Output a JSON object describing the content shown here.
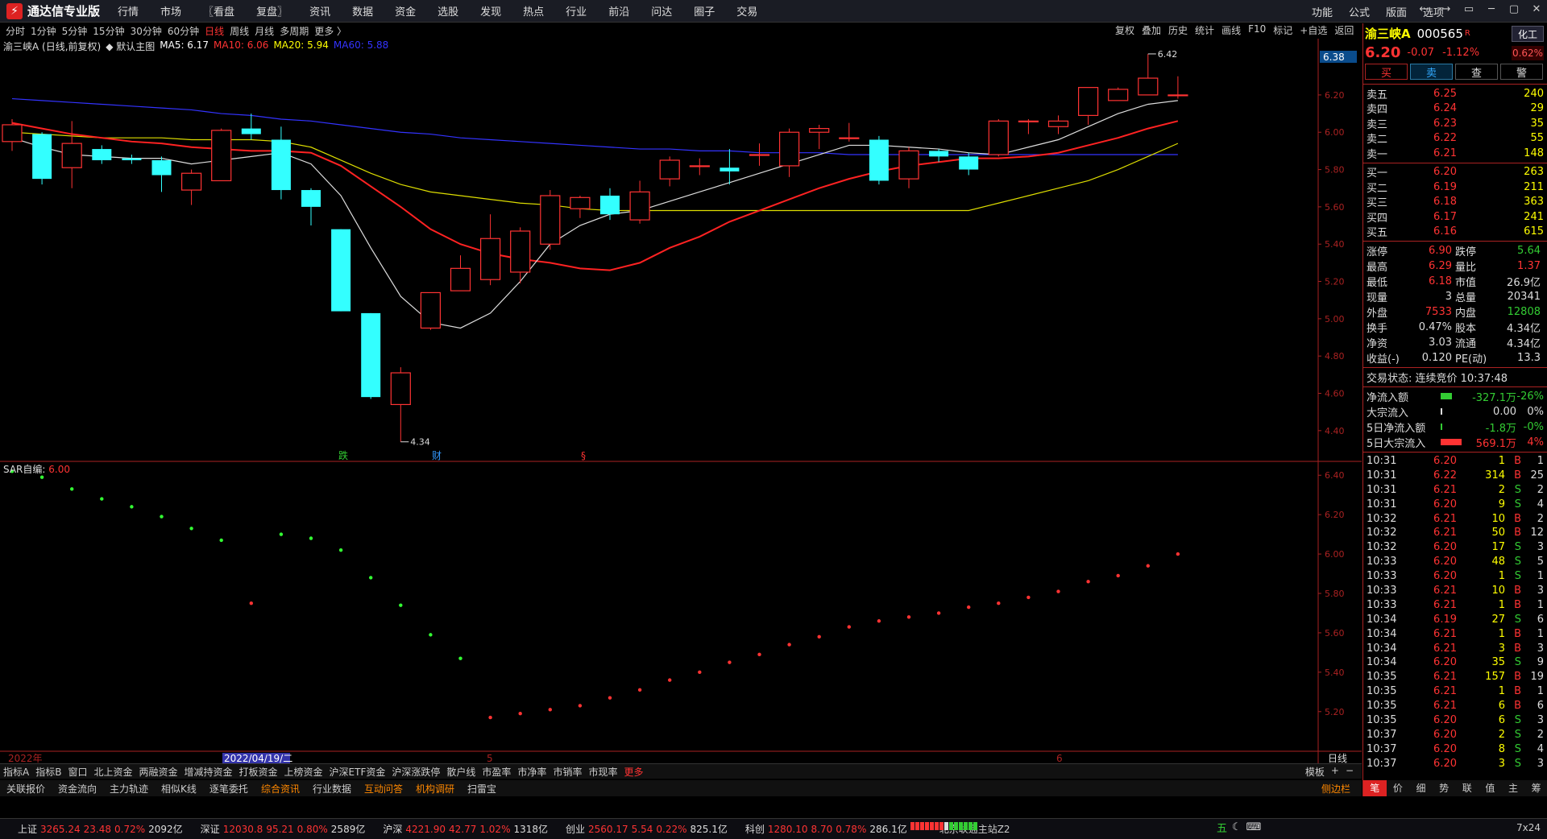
{
  "app": {
    "name": "通达信专业版"
  },
  "menu": [
    "行情",
    "市场",
    "〖看盘",
    "复盘〗",
    "资讯",
    "数据",
    "资金",
    "选股",
    "发现",
    "热点",
    "行业",
    "前沿",
    "问达",
    "圈子",
    "交易"
  ],
  "right_menu": [
    "功能",
    "公式",
    "版面",
    "选项"
  ],
  "window_controls": [
    "←",
    "→",
    "▭",
    "─",
    "▢",
    "✕"
  ],
  "periods": [
    "分时",
    "1分钟",
    "5分钟",
    "15分钟",
    "30分钟",
    "60分钟",
    "日线",
    "周线",
    "月线",
    "多周期",
    "更多 〉"
  ],
  "active_period": "日线",
  "chart_tools": [
    "复权",
    "叠加",
    "历史",
    "统计",
    "画线",
    "F10",
    "标记",
    "+自选",
    "返回"
  ],
  "info_line": {
    "name": "渝三峡A (日线,前复权)",
    "main_label": "◆ 默认主图",
    "ma5": "MA5: 6.17",
    "ma10": "MA10: 6.06",
    "ma20": "MA20: 5.94",
    "ma60": "MA60: 5.88"
  },
  "sar_line": {
    "label": "SAR自编",
    "value": "6.00"
  },
  "chart_data": {
    "type": "candlestick",
    "ylim": [
      4.3,
      6.45
    ],
    "yticks": [
      "6.20",
      "6.00",
      "5.80",
      "5.60",
      "5.40",
      "5.20",
      "5.00",
      "4.80",
      "4.60",
      "4.40"
    ],
    "top_label": "6.38",
    "high_label": "6.42",
    "low_label": "4.34",
    "x_labels": [
      "2022年",
      "2022/04/19/二",
      "5",
      "6"
    ],
    "markers": [
      "跌",
      "财",
      "§"
    ],
    "candles": [
      {
        "o": 5.95,
        "c": 6.04,
        "h": 6.07,
        "l": 5.9
      },
      {
        "o": 5.99,
        "c": 5.75,
        "h": 6.0,
        "l": 5.72
      },
      {
        "o": 5.81,
        "c": 5.94,
        "h": 6.06,
        "l": 5.7
      },
      {
        "o": 5.91,
        "c": 5.85,
        "h": 5.93,
        "l": 5.83
      },
      {
        "o": 5.86,
        "c": 5.85,
        "h": 5.88,
        "l": 5.83
      },
      {
        "o": 5.85,
        "c": 5.77,
        "h": 5.87,
        "l": 5.68
      },
      {
        "o": 5.69,
        "c": 5.78,
        "h": 5.8,
        "l": 5.61
      },
      {
        "o": 5.74,
        "c": 6.01,
        "h": 6.02,
        "l": 5.74
      },
      {
        "o": 6.02,
        "c": 5.99,
        "h": 6.1,
        "l": 5.96
      },
      {
        "o": 5.96,
        "c": 5.69,
        "h": 6.03,
        "l": 5.64
      },
      {
        "o": 5.69,
        "c": 5.6,
        "h": 5.7,
        "l": 5.5
      },
      {
        "o": 5.48,
        "c": 5.04,
        "h": 5.48,
        "l": 5.04
      },
      {
        "o": 5.03,
        "c": 4.58,
        "h": 5.03,
        "l": 4.57
      },
      {
        "o": 4.54,
        "c": 4.71,
        "h": 4.74,
        "l": 4.34
      },
      {
        "o": 4.95,
        "c": 5.14,
        "h": 5.14,
        "l": 4.94
      },
      {
        "o": 5.15,
        "c": 5.27,
        "h": 5.34,
        "l": 5.15
      },
      {
        "o": 5.21,
        "c": 5.43,
        "h": 5.56,
        "l": 5.18
      },
      {
        "o": 5.25,
        "c": 5.47,
        "h": 5.49,
        "l": 5.19
      },
      {
        "o": 5.4,
        "c": 5.66,
        "h": 5.69,
        "l": 5.37
      },
      {
        "o": 5.59,
        "c": 5.65,
        "h": 5.66,
        "l": 5.54
      },
      {
        "o": 5.66,
        "c": 5.56,
        "h": 5.7,
        "l": 5.53
      },
      {
        "o": 5.53,
        "c": 5.68,
        "h": 5.74,
        "l": 5.51
      },
      {
        "o": 5.75,
        "c": 5.85,
        "h": 5.87,
        "l": 5.71
      },
      {
        "o": 5.82,
        "c": 5.82,
        "h": 5.86,
        "l": 5.77
      },
      {
        "o": 5.81,
        "c": 5.79,
        "h": 5.91,
        "l": 5.72
      },
      {
        "o": 5.88,
        "c": 5.88,
        "h": 5.94,
        "l": 5.82
      },
      {
        "o": 5.82,
        "c": 6.0,
        "h": 6.02,
        "l": 5.76
      },
      {
        "o": 6.0,
        "c": 6.02,
        "h": 6.04,
        "l": 5.91
      },
      {
        "o": 5.97,
        "c": 5.97,
        "h": 6.05,
        "l": 5.95
      },
      {
        "o": 5.96,
        "c": 5.74,
        "h": 5.98,
        "l": 5.72
      },
      {
        "o": 5.75,
        "c": 5.9,
        "h": 5.92,
        "l": 5.7
      },
      {
        "o": 5.9,
        "c": 5.87,
        "h": 5.91,
        "l": 5.84
      },
      {
        "o": 5.87,
        "c": 5.8,
        "h": 5.89,
        "l": 5.77
      },
      {
        "o": 5.88,
        "c": 6.06,
        "h": 6.07,
        "l": 5.87
      },
      {
        "o": 6.06,
        "c": 6.06,
        "h": 6.07,
        "l": 5.99
      },
      {
        "o": 6.03,
        "c": 6.06,
        "h": 6.09,
        "l": 5.99
      },
      {
        "o": 6.09,
        "c": 6.24,
        "h": 6.24,
        "l": 6.04
      },
      {
        "o": 6.17,
        "c": 6.23,
        "h": 6.24,
        "l": 6.17
      },
      {
        "o": 6.2,
        "c": 6.29,
        "h": 6.42,
        "l": 6.2
      },
      {
        "o": 6.2,
        "c": 6.2,
        "h": 6.3,
        "l": 6.18
      }
    ],
    "ma5": [
      5.97,
      5.92,
      5.88,
      5.87,
      5.86,
      5.86,
      5.83,
      5.85,
      5.87,
      5.89,
      5.83,
      5.66,
      5.38,
      5.12,
      4.98,
      4.95,
      5.03,
      5.2,
      5.4,
      5.5,
      5.56,
      5.58,
      5.63,
      5.68,
      5.73,
      5.78,
      5.83,
      5.88,
      5.93,
      5.93,
      5.92,
      5.91,
      5.89,
      5.88,
      5.92,
      5.96,
      6.03,
      6.1,
      6.15,
      6.17
    ],
    "ma10": [
      6.05,
      6.02,
      5.99,
      5.97,
      5.95,
      5.94,
      5.92,
      5.91,
      5.9,
      5.9,
      5.89,
      5.82,
      5.71,
      5.6,
      5.48,
      5.4,
      5.35,
      5.32,
      5.3,
      5.27,
      5.26,
      5.3,
      5.38,
      5.44,
      5.52,
      5.58,
      5.64,
      5.7,
      5.75,
      5.79,
      5.82,
      5.84,
      5.86,
      5.86,
      5.87,
      5.89,
      5.93,
      5.97,
      6.02,
      6.06
    ],
    "ma20": [
      6.0,
      5.99,
      5.98,
      5.97,
      5.97,
      5.97,
      5.96,
      5.96,
      5.96,
      5.95,
      5.92,
      5.85,
      5.78,
      5.72,
      5.68,
      5.66,
      5.64,
      5.62,
      5.61,
      5.59,
      5.58,
      5.58,
      5.58,
      5.58,
      5.58,
      5.58,
      5.58,
      5.58,
      5.58,
      5.58,
      5.58,
      5.58,
      5.58,
      5.62,
      5.66,
      5.7,
      5.74,
      5.8,
      5.87,
      5.94
    ],
    "ma60": [
      6.18,
      6.17,
      6.16,
      6.15,
      6.14,
      6.13,
      6.12,
      6.1,
      6.09,
      6.07,
      6.06,
      6.04,
      6.02,
      6.0,
      5.99,
      5.97,
      5.96,
      5.95,
      5.94,
      5.93,
      5.92,
      5.91,
      5.91,
      5.9,
      5.9,
      5.89,
      5.89,
      5.89,
      5.88,
      5.88,
      5.88,
      5.88,
      5.88,
      5.88,
      5.88,
      5.88,
      5.88,
      5.88,
      5.88,
      5.88
    ],
    "ma60_start_index": 0,
    "sar": {
      "ylim": [
        5.15,
        6.45
      ],
      "yticks": [
        "6.40",
        "6.20",
        "6.00",
        "5.80",
        "5.60",
        "5.40",
        "5.20"
      ],
      "points": [
        {
          "i": 0,
          "v": 6.42,
          "up": false
        },
        {
          "i": 1,
          "v": 6.39,
          "up": false
        },
        {
          "i": 2,
          "v": 6.33,
          "up": false
        },
        {
          "i": 3,
          "v": 6.28,
          "up": false
        },
        {
          "i": 4,
          "v": 6.24,
          "up": false
        },
        {
          "i": 5,
          "v": 6.19,
          "up": false
        },
        {
          "i": 6,
          "v": 6.13,
          "up": false
        },
        {
          "i": 7,
          "v": 6.07,
          "up": false
        },
        {
          "i": 9,
          "v": 6.1,
          "up": false
        },
        {
          "i": 10,
          "v": 6.08,
          "up": false
        },
        {
          "i": 11,
          "v": 6.02,
          "up": false
        },
        {
          "i": 12,
          "v": 5.88,
          "up": false
        },
        {
          "i": 8,
          "v": 5.75,
          "up": true
        },
        {
          "i": 13,
          "v": 5.74,
          "up": false
        },
        {
          "i": 14,
          "v": 5.59,
          "up": false
        },
        {
          "i": 15,
          "v": 5.47,
          "up": false
        },
        {
          "i": 16,
          "v": 5.17,
          "up": true
        },
        {
          "i": 17,
          "v": 5.19,
          "up": true
        },
        {
          "i": 18,
          "v": 5.21,
          "up": true
        },
        {
          "i": 19,
          "v": 5.23,
          "up": true
        },
        {
          "i": 20,
          "v": 5.27,
          "up": true
        },
        {
          "i": 21,
          "v": 5.31,
          "up": true
        },
        {
          "i": 22,
          "v": 5.36,
          "up": true
        },
        {
          "i": 23,
          "v": 5.4,
          "up": true
        },
        {
          "i": 24,
          "v": 5.45,
          "up": true
        },
        {
          "i": 25,
          "v": 5.49,
          "up": true
        },
        {
          "i": 26,
          "v": 5.54,
          "up": true
        },
        {
          "i": 27,
          "v": 5.58,
          "up": true
        },
        {
          "i": 28,
          "v": 5.63,
          "up": true
        },
        {
          "i": 29,
          "v": 5.66,
          "up": true
        },
        {
          "i": 30,
          "v": 5.68,
          "up": true
        },
        {
          "i": 31,
          "v": 5.7,
          "up": true
        },
        {
          "i": 32,
          "v": 5.73,
          "up": true
        },
        {
          "i": 33,
          "v": 5.75,
          "up": true
        },
        {
          "i": 34,
          "v": 5.78,
          "up": true
        },
        {
          "i": 35,
          "v": 5.81,
          "up": true
        },
        {
          "i": 36,
          "v": 5.86,
          "up": true
        },
        {
          "i": 37,
          "v": 5.89,
          "up": true
        },
        {
          "i": 38,
          "v": 5.94,
          "up": true
        },
        {
          "i": 39,
          "v": 6.0,
          "up": true
        }
      ]
    }
  },
  "stock": {
    "name": "渝三峡A",
    "code": "000565",
    "tag": "R",
    "sector": "化工",
    "price": "6.20",
    "change": "-0.07",
    "pct": "-1.12%",
    "badge": "0.62%"
  },
  "trade_buttons": [
    "买",
    "卖",
    "查",
    "警"
  ],
  "asks": [
    {
      "l": "卖五",
      "p": "6.25",
      "v": "240"
    },
    {
      "l": "卖四",
      "p": "6.24",
      "v": "29"
    },
    {
      "l": "卖三",
      "p": "6.23",
      "v": "35"
    },
    {
      "l": "卖二",
      "p": "6.22",
      "v": "55"
    },
    {
      "l": "卖一",
      "p": "6.21",
      "v": "148"
    }
  ],
  "bids": [
    {
      "l": "买一",
      "p": "6.20",
      "v": "263"
    },
    {
      "l": "买二",
      "p": "6.19",
      "v": "211"
    },
    {
      "l": "买三",
      "p": "6.18",
      "v": "363"
    },
    {
      "l": "买四",
      "p": "6.17",
      "v": "241"
    },
    {
      "l": "买五",
      "p": "6.16",
      "v": "615"
    }
  ],
  "stats": [
    {
      "l": "涨停",
      "v": "6.90",
      "c": "red"
    },
    {
      "l": "跌停",
      "v": "5.64",
      "c": "green"
    },
    {
      "l": "最高",
      "v": "6.29",
      "c": "red"
    },
    {
      "l": "量比",
      "v": "1.37",
      "c": "red"
    },
    {
      "l": "最低",
      "v": "6.18",
      "c": "red"
    },
    {
      "l": "市值",
      "v": "26.9亿",
      "c": "wht"
    },
    {
      "l": "现量",
      "v": "3",
      "c": "wht"
    },
    {
      "l": "总量",
      "v": "20341",
      "c": "wht"
    },
    {
      "l": "外盘",
      "v": "7533",
      "c": "red"
    },
    {
      "l": "内盘",
      "v": "12808",
      "c": "green"
    },
    {
      "l": "换手",
      "v": "0.47%",
      "c": "wht"
    },
    {
      "l": "股本",
      "v": "4.34亿",
      "c": "wht"
    },
    {
      "l": "净资",
      "v": "3.03",
      "c": "wht"
    },
    {
      "l": "流通",
      "v": "4.34亿",
      "c": "wht"
    },
    {
      "l": "收益(-)",
      "v": "0.120",
      "c": "wht"
    },
    {
      "l": "PE(动)",
      "v": "13.3",
      "c": "wht"
    }
  ],
  "trade_status": "交易状态: 连续竞价 10:37:48",
  "flows": [
    {
      "l": "净流入额",
      "v": "-327.1万",
      "p": "-26%",
      "c": "green",
      "w": 14
    },
    {
      "l": "大宗流入",
      "v": "0.00",
      "p": "0%",
      "c": "wht",
      "w": 2
    },
    {
      "l": "5日净流入额",
      "v": "-1.8万",
      "p": "-0%",
      "c": "green",
      "w": 2
    },
    {
      "l": "5日大宗流入",
      "v": "569.1万",
      "p": "4%",
      "c": "red",
      "w": 26
    }
  ],
  "ticks": [
    {
      "t": "10:31",
      "p": "6.20",
      "v": "1",
      "d": "B",
      "n": "1"
    },
    {
      "t": "10:31",
      "p": "6.22",
      "v": "314",
      "d": "B",
      "n": "25"
    },
    {
      "t": "10:31",
      "p": "6.21",
      "v": "2",
      "d": "S",
      "n": "2"
    },
    {
      "t": "10:31",
      "p": "6.20",
      "v": "9",
      "d": "S",
      "n": "4"
    },
    {
      "t": "10:32",
      "p": "6.21",
      "v": "10",
      "d": "B",
      "n": "2"
    },
    {
      "t": "10:32",
      "p": "6.21",
      "v": "50",
      "d": "B",
      "n": "12"
    },
    {
      "t": "10:32",
      "p": "6.20",
      "v": "17",
      "d": "S",
      "n": "3"
    },
    {
      "t": "10:33",
      "p": "6.20",
      "v": "48",
      "d": "S",
      "n": "5"
    },
    {
      "t": "10:33",
      "p": "6.20",
      "v": "1",
      "d": "S",
      "n": "1"
    },
    {
      "t": "10:33",
      "p": "6.21",
      "v": "10",
      "d": "B",
      "n": "3"
    },
    {
      "t": "10:33",
      "p": "6.21",
      "v": "1",
      "d": "B",
      "n": "1"
    },
    {
      "t": "10:34",
      "p": "6.19",
      "v": "27",
      "d": "S",
      "n": "6"
    },
    {
      "t": "10:34",
      "p": "6.21",
      "v": "1",
      "d": "B",
      "n": "1"
    },
    {
      "t": "10:34",
      "p": "6.21",
      "v": "3",
      "d": "B",
      "n": "3"
    },
    {
      "t": "10:34",
      "p": "6.20",
      "v": "35",
      "d": "S",
      "n": "9"
    },
    {
      "t": "10:35",
      "p": "6.21",
      "v": "157",
      "d": "B",
      "n": "19"
    },
    {
      "t": "10:35",
      "p": "6.21",
      "v": "1",
      "d": "B",
      "n": "1"
    },
    {
      "t": "10:35",
      "p": "6.21",
      "v": "6",
      "d": "B",
      "n": "6"
    },
    {
      "t": "10:35",
      "p": "6.20",
      "v": "6",
      "d": "S",
      "n": "3"
    },
    {
      "t": "10:37",
      "p": "6.20",
      "v": "2",
      "d": "S",
      "n": "2"
    },
    {
      "t": "10:37",
      "p": "6.20",
      "v": "8",
      "d": "S",
      "n": "4"
    },
    {
      "t": "10:37",
      "p": "6.20",
      "v": "3",
      "d": "S",
      "n": "3"
    }
  ],
  "side_tabs": [
    "笔",
    "价",
    "细",
    "势",
    "联",
    "值",
    "主",
    "筹"
  ],
  "tabbar1": [
    "指标A",
    "指标B",
    "窗口",
    "北上资金",
    "两融资金",
    "增减持资金",
    "打板资金",
    "上榜资金",
    "沪深ETF资金",
    "沪深涨跌停",
    "散户线",
    "市盈率",
    "市净率",
    "市销率",
    "市现率",
    "更多"
  ],
  "tabbar1_right": [
    "模板",
    "+",
    "−"
  ],
  "tabbar2": [
    "关联报价",
    "资金流向",
    "主力轨迹",
    "相似K线",
    "逐笔委托",
    "综合资讯",
    "行业数据",
    "互动问答",
    "机构调研",
    "扫雷宝"
  ],
  "tabbar2_highlight": [
    "综合资讯",
    "互动问答",
    "机构调研"
  ],
  "tabbar2_right": "侧边栏",
  "status_items": [
    {
      "n": "上证",
      "v": "3265.24",
      "c": "23.48",
      "p": "0.72%",
      "a": "2092亿"
    },
    {
      "n": "深证",
      "v": "12030.8",
      "c": "95.21",
      "p": "0.80%",
      "a": "2589亿"
    },
    {
      "n": "沪深",
      "v": "4221.90",
      "c": "42.77",
      "p": "1.02%",
      "a": "1318亿"
    },
    {
      "n": "创业",
      "v": "2560.17",
      "c": "5.54",
      "p": "0.22%",
      "a": "825.1亿"
    },
    {
      "n": "科创",
      "v": "1280.10",
      "c": "8.70",
      "p": "0.78%",
      "a": "286.1亿"
    }
  ],
  "server": "北京联通主站Z2",
  "status_right": "7x24",
  "status_icons": [
    "五"
  ]
}
